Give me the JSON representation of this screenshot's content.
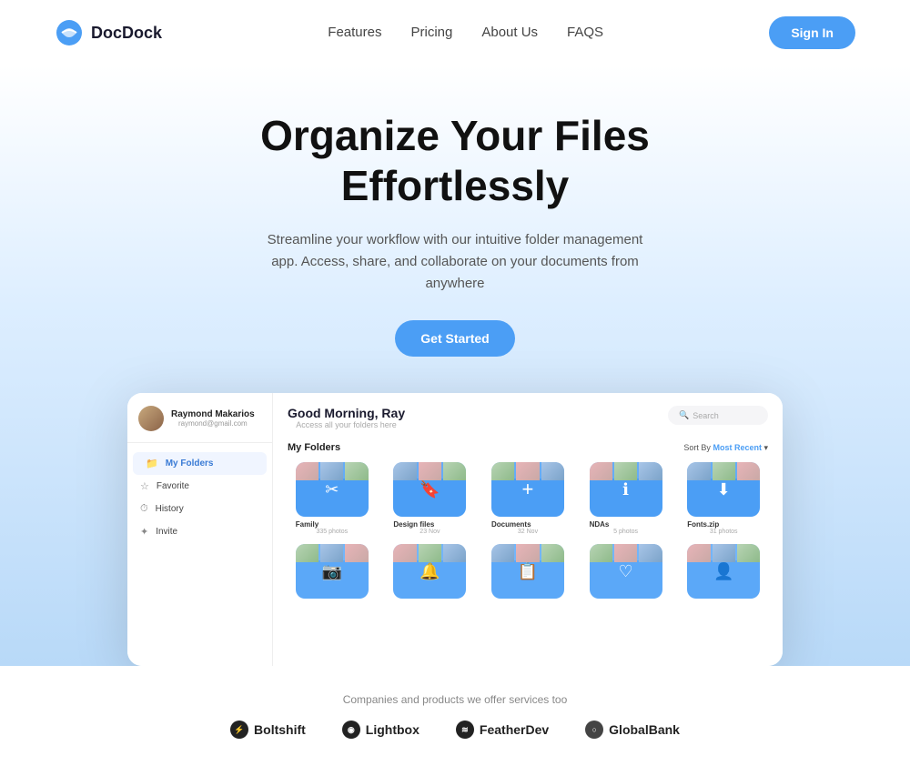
{
  "brand": {
    "name": "DocDock"
  },
  "navbar": {
    "links": [
      {
        "label": "Features",
        "id": "features"
      },
      {
        "label": "Pricing",
        "id": "pricing"
      },
      {
        "label": "About Us",
        "id": "about"
      },
      {
        "label": "FAQS",
        "id": "faqs"
      }
    ],
    "sign_in": "Sign In"
  },
  "hero": {
    "headline_line1": "Organize Your Files",
    "headline_line2": "Effortlessly",
    "subtext": "Streamline your workflow with our intuitive folder management app. Access, share, and collaborate on your documents from anywhere",
    "cta": "Get Started"
  },
  "app": {
    "user": {
      "name": "Raymond Makarios",
      "email": "raymond@gmail.com"
    },
    "greeting": "Good Morning, Ray",
    "greeting_sub": "Access all your folders here",
    "search_placeholder": "Search",
    "sidebar_nav": [
      {
        "label": "My Folders",
        "active": true
      },
      {
        "label": "Favorite"
      },
      {
        "label": "History"
      },
      {
        "label": "Invite"
      }
    ],
    "folders_title": "My Folders",
    "sort_label": "Sort By",
    "sort_value": "Most Recent",
    "folders_row1": [
      {
        "name": "Family",
        "meta": "335 photos",
        "icon": "✂"
      },
      {
        "name": "Design files",
        "meta": "23 Nov",
        "icon": "🔖"
      },
      {
        "name": "Documents",
        "meta": "32 Nov",
        "icon": "+"
      },
      {
        "name": "NDAs",
        "meta": "5 photos",
        "icon": "ℹ"
      },
      {
        "name": "Fonts.zip",
        "meta": "31 photos",
        "icon": "⬇"
      }
    ],
    "folders_row2": [
      {
        "name": "",
        "meta": "",
        "icon": "📷"
      },
      {
        "name": "",
        "meta": "",
        "icon": "🔔"
      },
      {
        "name": "",
        "meta": "",
        "icon": "📋"
      },
      {
        "name": "",
        "meta": "",
        "icon": "♡"
      },
      {
        "name": "",
        "meta": "",
        "icon": "👤"
      }
    ]
  },
  "companies": {
    "label": "Companies and products we offer services too",
    "logos": [
      {
        "name": "Boltshift",
        "symbol": "⚡"
      },
      {
        "name": "Lightbox",
        "symbol": "◉"
      },
      {
        "name": "FeatherDev",
        "symbol": "≋"
      },
      {
        "name": "GlobalBank",
        "symbol": "○"
      }
    ]
  }
}
